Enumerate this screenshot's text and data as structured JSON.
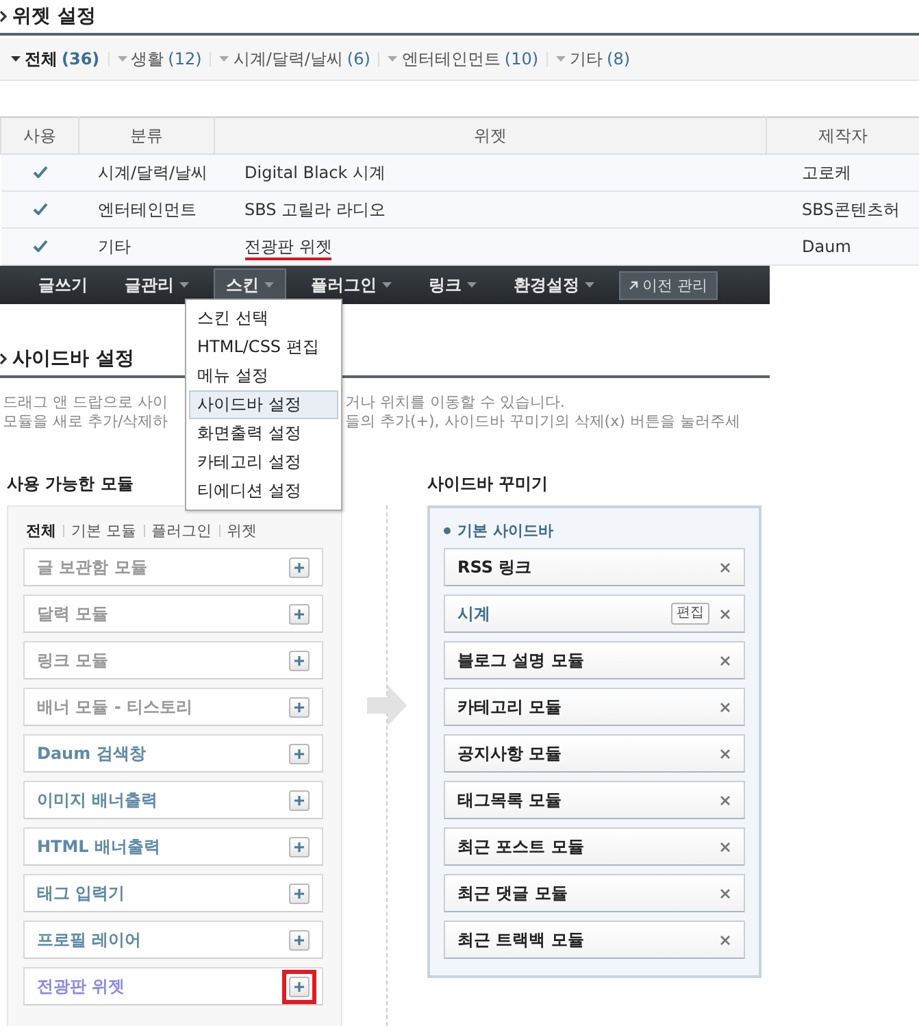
{
  "widget_settings": {
    "title": "위젯 설정",
    "filters": [
      {
        "label": "전체",
        "count": "(36)",
        "selected": true
      },
      {
        "label": "생활",
        "count": "(12)",
        "selected": false
      },
      {
        "label": "시계/달력/날씨",
        "count": "(6)",
        "selected": false
      },
      {
        "label": "엔터테인먼트",
        "count": "(10)",
        "selected": false
      },
      {
        "label": "기타",
        "count": "(8)",
        "selected": false
      }
    ],
    "table": {
      "columns": [
        "사용",
        "분류",
        "위젯",
        "제작자"
      ],
      "rows": [
        {
          "used": true,
          "category": "시계/달력/날씨",
          "widget": "Digital Black 시계",
          "author": "고로케",
          "annotated": false
        },
        {
          "used": true,
          "category": "엔터테인먼트",
          "widget": "SBS 고릴라 라디오",
          "author": "SBS콘텐츠허",
          "annotated": false
        },
        {
          "used": true,
          "category": "기타",
          "widget": "전광판 위젯",
          "author": "Daum",
          "annotated": true
        }
      ]
    }
  },
  "nav": {
    "items": [
      {
        "label": "글쓰기",
        "has_menu": false,
        "selected": false
      },
      {
        "label": "글관리",
        "has_menu": true,
        "selected": false
      },
      {
        "label": "스킨",
        "has_menu": true,
        "selected": true
      },
      {
        "label": "플러그인",
        "has_menu": true,
        "selected": false
      },
      {
        "label": "링크",
        "has_menu": true,
        "selected": false
      },
      {
        "label": "환경설정",
        "has_menu": true,
        "selected": false
      }
    ],
    "legacy_button": "이전 관리",
    "menu": [
      {
        "label": "스킨 선택",
        "selected": false
      },
      {
        "label": "HTML/CSS 편집",
        "selected": false
      },
      {
        "label": "메뉴 설정",
        "selected": false
      },
      {
        "label": "사이드바 설정",
        "selected": true
      },
      {
        "label": "화면출력 설정",
        "selected": false
      },
      {
        "label": "카테고리 설정",
        "selected": false
      },
      {
        "label": "티에디션 설정",
        "selected": false
      }
    ]
  },
  "sidebar_settings": {
    "title": "사이드바 설정",
    "description": [
      {
        "before": "드래그 앤 드랍으로 사이",
        "after": "거나 위치를 이동할 수 있습니다."
      },
      {
        "before": "모듈을 새로 추가/삭제하",
        "after": "들의 추가(+), 사이드바 꾸미기의 삭제(x) 버튼을 눌러주세"
      }
    ],
    "available": {
      "title": "사용 가능한 모듈",
      "tabs": [
        {
          "label": "전체",
          "selected": true
        },
        {
          "label": "기본 모듈",
          "selected": false
        },
        {
          "label": "플러그인",
          "selected": false
        },
        {
          "label": "위젯",
          "selected": false
        }
      ],
      "modules": [
        {
          "label": "글 보관함 모듈",
          "kind": "used",
          "annotated": false
        },
        {
          "label": "달력 모듈",
          "kind": "used",
          "annotated": false
        },
        {
          "label": "링크 모듈",
          "kind": "used",
          "annotated": false
        },
        {
          "label": "배너 모듈 - 티스토리",
          "kind": "used",
          "annotated": false
        },
        {
          "label": "Daum 검색창",
          "kind": "free",
          "annotated": false
        },
        {
          "label": "이미지 배너출력",
          "kind": "free",
          "annotated": false
        },
        {
          "label": "HTML 배너출력",
          "kind": "free",
          "annotated": false
        },
        {
          "label": "태그 입력기",
          "kind": "free",
          "annotated": false
        },
        {
          "label": "프로필 레이어",
          "kind": "free",
          "annotated": false
        },
        {
          "label": "전광판 위젯",
          "kind": "widget",
          "annotated": true
        }
      ]
    },
    "decorator": {
      "title": "사이드바 꾸미기",
      "group": "기본 사이드바",
      "modules": [
        {
          "label": "RSS 링크",
          "kind": "module"
        },
        {
          "label": "시계",
          "kind": "widget",
          "edit_label": "편집"
        },
        {
          "label": "블로그 설명 모듈",
          "kind": "module"
        },
        {
          "label": "카테고리 모듈",
          "kind": "module"
        },
        {
          "label": "공지사항 모듈",
          "kind": "module"
        },
        {
          "label": "태그목록 모듈",
          "kind": "module"
        },
        {
          "label": "최근 포스트 모듈",
          "kind": "module"
        },
        {
          "label": "최근 댓글 모듈",
          "kind": "module"
        },
        {
          "label": "최근 트랙백 모듈",
          "kind": "module"
        }
      ]
    }
  }
}
